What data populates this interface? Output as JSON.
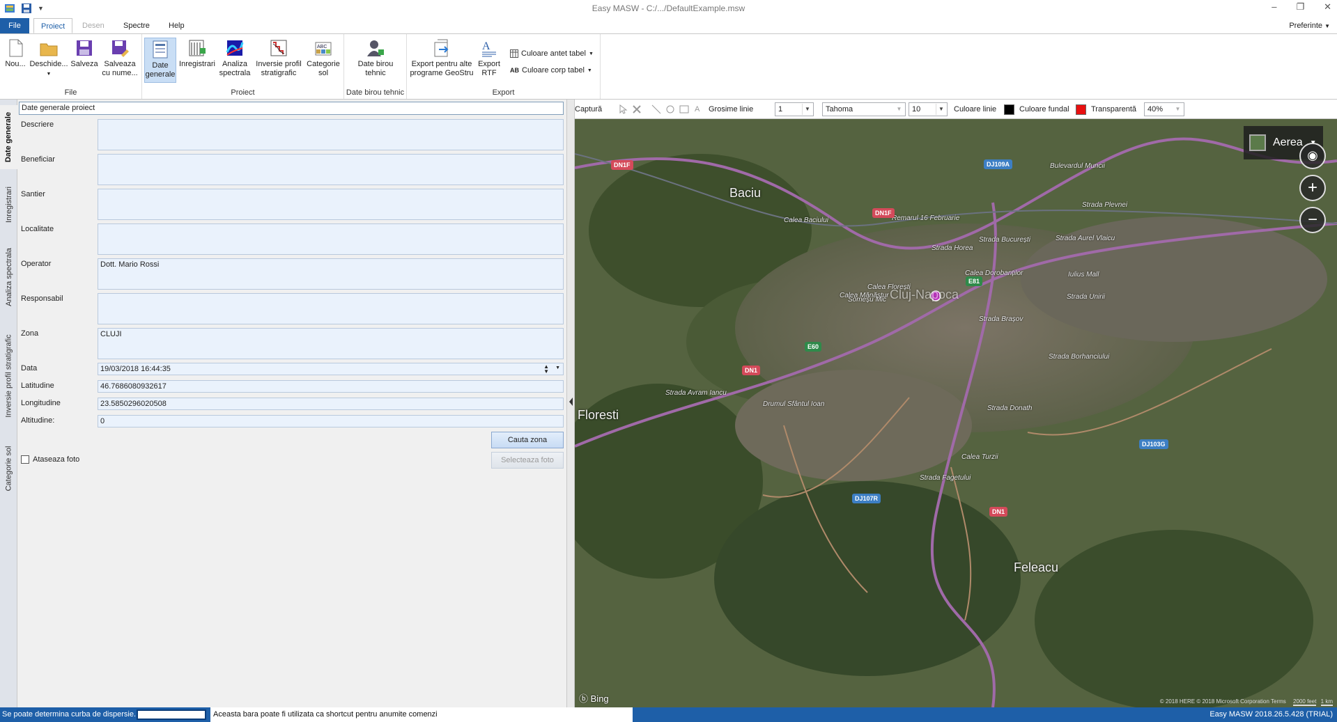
{
  "window": {
    "title": "Easy MASW - C:/.../DefaultExample.msw",
    "minimize": "–",
    "restore": "❐",
    "close": "✕"
  },
  "ribbon": {
    "tabs": [
      {
        "label": "File"
      },
      {
        "label": "Proiect"
      },
      {
        "label": "Desen"
      },
      {
        "label": "Spectre"
      },
      {
        "label": "Help"
      }
    ],
    "preferences": "Preferinte",
    "file_group": {
      "label": "File",
      "new": "Nou...",
      "open": "Deschide...",
      "save": "Salveza",
      "save_as_1": "Salveaza",
      "save_as_2": "cu nume..."
    },
    "proiect_group": {
      "label": "Proiect",
      "general_1": "Date",
      "general_2": "generale",
      "recordings": "Inregistrari",
      "spectral_1": "Analiza",
      "spectral_2": "spectrala",
      "inversion_1": "Inversie profil",
      "inversion_2": "stratigrafic",
      "soil_1": "Categorie",
      "soil_2": "sol"
    },
    "office_group": {
      "label": "Date birou tehnic",
      "btn_1": "Date birou",
      "btn_2": "tehnic"
    },
    "export_group": {
      "label": "Export",
      "geostru_1": "Export pentru alte",
      "geostru_2": "programe GeoStru",
      "rtf_1": "Export",
      "rtf_2": "RTF",
      "table_header_color": "Culoare antet tabel",
      "table_body_color": "Culoare corp tabel"
    }
  },
  "side_tabs": [
    {
      "label": "Date generale"
    },
    {
      "label": "Inregistrari"
    },
    {
      "label": "Analiza spectrala"
    },
    {
      "label": "Inversie profil stratigrafic"
    },
    {
      "label": "Categorie sol"
    }
  ],
  "form": {
    "header": "Date generale proiect",
    "fields": {
      "descriere": {
        "label": "Descriere",
        "value": ""
      },
      "beneficiar": {
        "label": "Beneficiar",
        "value": ""
      },
      "santier": {
        "label": "Santier",
        "value": ""
      },
      "localitate": {
        "label": "Localitate",
        "value": ""
      },
      "operator": {
        "label": "Operator",
        "value": "Dott. Mario Rossi"
      },
      "responsabil": {
        "label": "Responsabil",
        "value": ""
      },
      "zona": {
        "label": "Zona",
        "value": "CLUJI"
      },
      "data": {
        "label": "Data",
        "value": "19/03/2018 16:44:35"
      },
      "latitudine": {
        "label": "Latitudine",
        "value": "46.7686080932617"
      },
      "longitudine": {
        "label": "Longitudine",
        "value": "23.5850296020508"
      },
      "altitudine": {
        "label": "Altitudine:",
        "value": "0"
      }
    },
    "search_zone_button": "Cauta zona",
    "attach_photo": "Ataseaza foto",
    "select_photo_button": "Selecteaza foto"
  },
  "map_toolbar": {
    "capture": "Captură",
    "line_width_label": "Grosime linie",
    "line_width_value": "1",
    "font_value": "Tahoma",
    "font_size_value": "10",
    "line_color_label": "Culoare linie",
    "line_color": "#000000",
    "fill_color_label": "Culoare fundal",
    "fill_color": "#e81010",
    "transparency_label": "Transparentă",
    "transparency_value": "40%"
  },
  "map": {
    "mode": "Aerea",
    "brand": "Bing",
    "copyright": "© 2018 HERE © 2018 Microsoft Corporation Terms",
    "cities": [
      "Baciu",
      "Cluj-Napoca",
      "Floresti",
      "Feleacu"
    ],
    "streets": [
      "Calea Baciului",
      "Remarul 16 Februarie",
      "Strada Horea",
      "Strada București",
      "Strada Plevnei",
      "Bulevardul Muncii",
      "Strada Aurel Vlaicu",
      "Calea Dorobanților",
      "Calea Mănăștur",
      "Strada Avram Iancu",
      "Drumul Sfântul Ioan",
      "Strada Borhanciului",
      "Strada Fagetului",
      "Calea Turzii",
      "Iulius Mall",
      "Strada Unirii",
      "Strada Brașov",
      "Calea Florești",
      "Strada Donath",
      "Someșu Mic"
    ],
    "shields": [
      "DN1F",
      "DN1F",
      "DJ109A",
      "E81",
      "E60",
      "DN1",
      "DJ103G",
      "DJ107R",
      "DN1"
    ],
    "scale_1": "2000 feet",
    "scale_2": "1 km"
  },
  "status": {
    "message": "Se poate determina curba de dispersie.",
    "hint": "Aceasta bara poate fi utilizata ca shortcut pentru anumite comenzi",
    "version": "Easy MASW 2018.26.5.428 (TRIAL)"
  }
}
